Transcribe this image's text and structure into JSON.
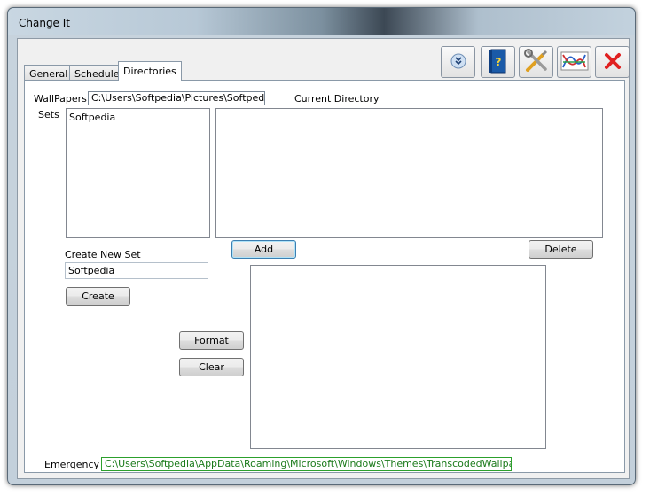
{
  "window": {
    "title": "Change It"
  },
  "tabs": [
    {
      "label": "General"
    },
    {
      "label": "Schedule"
    },
    {
      "label": "Directories"
    }
  ],
  "toolbar": {
    "icons": [
      "collapse-icon",
      "help-book-icon",
      "tools-icon",
      "graph-icon",
      "close-x-icon"
    ],
    "colors": {
      "close": "#e02020",
      "book": "#1a5aa8"
    }
  },
  "directories": {
    "wallpapers_label": "WallPapers",
    "wallpapers_path": "C:\\Users\\Softpedia\\Pictures\\Softpedia",
    "current_directory_label": "Current Directory",
    "sets_label": "Sets",
    "sets": [
      "Softpedia"
    ],
    "add_label": "Add",
    "delete_label": "Delete",
    "create_new_set_label": "Create New Set",
    "new_set_value": "Softpedia",
    "create_label": "Create",
    "format_label": "Format",
    "clear_label": "Clear",
    "emergency_label": "Emergency",
    "emergency_path": "C:\\Users\\Softpedia\\AppData\\Roaming\\Microsoft\\Windows\\Themes\\TranscodedWallpaper.jpg"
  }
}
